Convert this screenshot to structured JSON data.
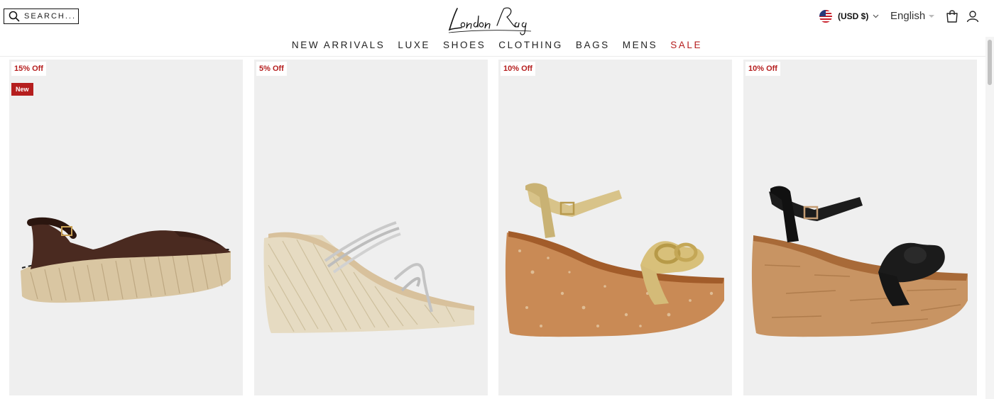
{
  "search": {
    "placeholder": "SEARCH..."
  },
  "brand": {
    "logo_text": "London Rag"
  },
  "currency": {
    "label": "(USD $)",
    "flag": "us-flag-icon"
  },
  "language": {
    "label": "English"
  },
  "icons": {
    "cart": "shopping-bag-icon",
    "account": "user-icon",
    "search": "search-icon"
  },
  "nav": {
    "items": [
      {
        "label": "NEW ARRIVALS"
      },
      {
        "label": "LUXE"
      },
      {
        "label": "SHOES"
      },
      {
        "label": "CLOTHING"
      },
      {
        "label": "BAGS"
      },
      {
        "label": "MENS"
      },
      {
        "label": "SALE"
      }
    ]
  },
  "products": [
    {
      "discount": "15% Off",
      "new_badge": "New",
      "image": "brown-slingback-espadrille-wedge"
    },
    {
      "discount": "5% Off",
      "image": "diamante-strap-espadrille-wedge"
    },
    {
      "discount": "10% Off",
      "image": "gold-chain-cork-wedge-sandal"
    },
    {
      "discount": "10% Off",
      "image": "black-knot-cork-wedge-sandal"
    }
  ],
  "colors": {
    "accent": "#b51e1e",
    "card_bg": "#efefef",
    "text": "#222222"
  }
}
